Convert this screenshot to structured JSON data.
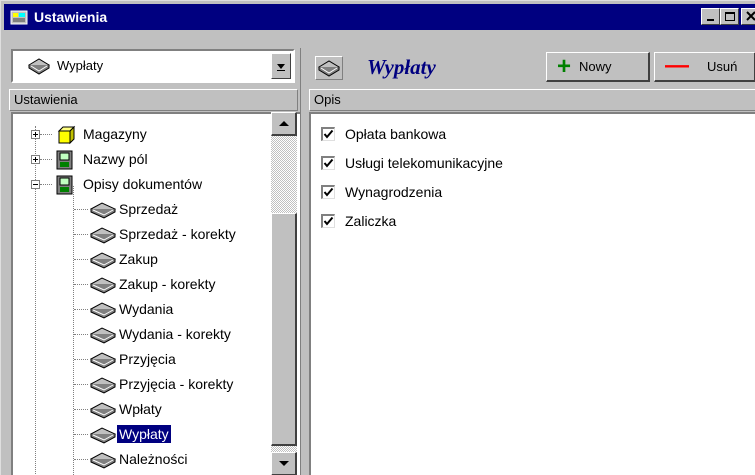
{
  "window": {
    "title": "Ustawienia"
  },
  "left": {
    "combo_value": "Wypłaty",
    "header": "Ustawienia",
    "tree": [
      {
        "label": "Magazyny",
        "icon": "yellow-cube-icon",
        "level": 0,
        "expander": "plus"
      },
      {
        "label": "Nazwy pól",
        "icon": "green-form-icon",
        "level": 0,
        "expander": "plus"
      },
      {
        "label": "Opisy dokumentów",
        "icon": "green-form-icon",
        "level": 0,
        "expander": "minus"
      },
      {
        "label": "Sprzedaż",
        "icon": "book-icon",
        "level": 1
      },
      {
        "label": "Sprzedaż - korekty",
        "icon": "book-icon",
        "level": 1
      },
      {
        "label": "Zakup",
        "icon": "book-icon",
        "level": 1
      },
      {
        "label": "Zakup - korekty",
        "icon": "book-icon",
        "level": 1
      },
      {
        "label": "Wydania",
        "icon": "book-icon",
        "level": 1
      },
      {
        "label": "Wydania - korekty",
        "icon": "book-icon",
        "level": 1
      },
      {
        "label": "Przyjęcia",
        "icon": "book-icon",
        "level": 1
      },
      {
        "label": "Przyjęcia - korekty",
        "icon": "book-icon",
        "level": 1
      },
      {
        "label": "Wpłaty",
        "icon": "book-icon",
        "level": 1
      },
      {
        "label": "Wypłaty",
        "icon": "book-icon",
        "level": 1,
        "selected": true
      },
      {
        "label": "Należności",
        "icon": "book-icon",
        "level": 1
      }
    ]
  },
  "right": {
    "title": "Wypłaty",
    "new_button": "Nowy",
    "delete_button": "Usuń",
    "header": "Opis",
    "items": [
      {
        "label": "Opłata bankowa",
        "checked": true
      },
      {
        "label": "Usługi telekomunikacyjne",
        "checked": true
      },
      {
        "label": "Wynagrodzenia",
        "checked": true
      },
      {
        "label": "Zaliczka",
        "checked": true
      }
    ]
  },
  "colors": {
    "titlebar": "#000080",
    "selection": "#000080",
    "face": "#c0c0c0",
    "add_green": "#008000",
    "delete_red": "#ff0000"
  }
}
